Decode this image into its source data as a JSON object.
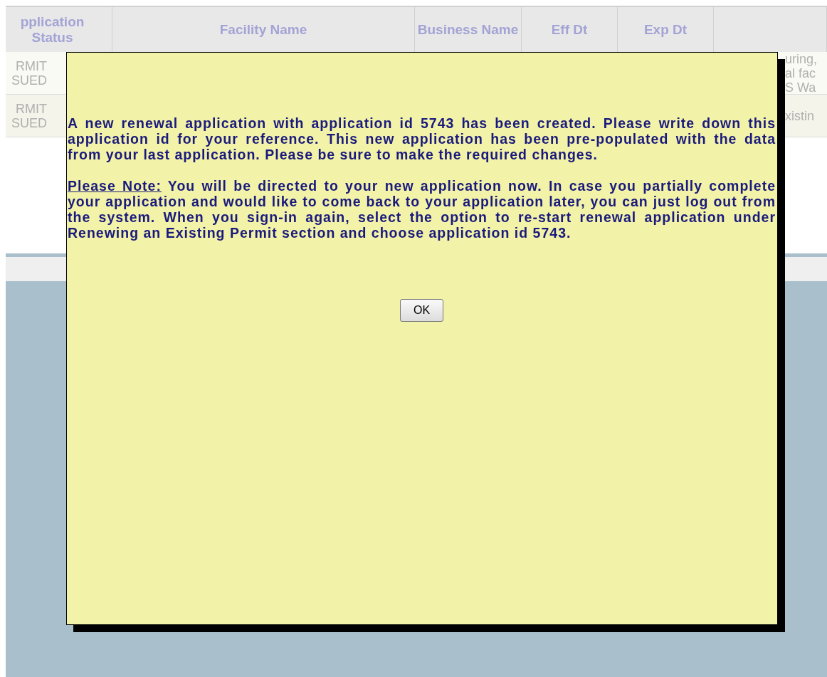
{
  "table": {
    "columns": [
      "pplication Status",
      "Facility Name",
      "Business Name",
      "Eff Dt",
      "Exp Dt",
      ""
    ],
    "rows": [
      {
        "cells": [
          [
            "RMIT",
            "SUED"
          ],
          [],
          [],
          [],
          [],
          [
            "uring,",
            "al fac",
            "S Wa"
          ]
        ]
      },
      {
        "cells": [
          [
            "RMIT",
            "SUED"
          ],
          [],
          [],
          [],
          [],
          [
            "xistin"
          ]
        ]
      }
    ]
  },
  "dialog": {
    "message": "A new renewal application with application id 5743 has been created. Please write down this application id for your reference. This new application has been pre-populated with the data from your last application. Please be sure to make the required changes.",
    "note_label": "Please Note:",
    "note_text": "You will be directed to your new application now. In case you partially complete your application and would like to come back to your application later, you can just log out from the system. When you sign-in again, select the option to re-start renewal application under Renewing an Existing Permit section and choose application id 5743.",
    "button": "OK"
  }
}
